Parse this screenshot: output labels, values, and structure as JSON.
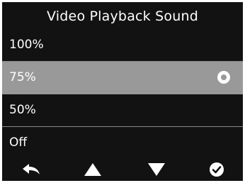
{
  "screen": {
    "title": "Video Playback Sound"
  },
  "menu": {
    "items": [
      {
        "label": "100%"
      },
      {
        "label": "75%",
        "selected": true
      },
      {
        "label": "50%"
      },
      {
        "label": "Off"
      }
    ]
  },
  "bottom_bar": {
    "buttons": [
      "back-icon",
      "up-arrow-icon",
      "down-arrow-icon",
      "confirm-check-icon"
    ]
  },
  "colors": {
    "background": "#121212",
    "selected_row": "#999999",
    "text": "#ffffff",
    "divider": "#8a8a8a"
  }
}
